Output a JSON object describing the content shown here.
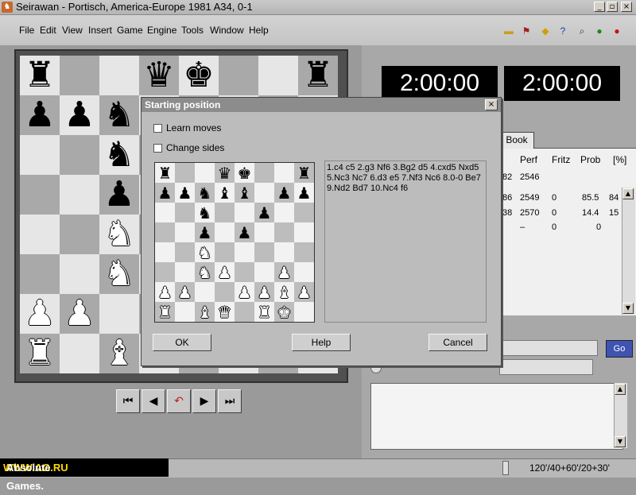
{
  "window": {
    "title": "Seirawan - Portisch, America-Europe 1981  A34, 0-1",
    "controls": [
      "_",
      "▫",
      "×"
    ]
  },
  "menu": [
    "File",
    "Edit",
    "View",
    "Insert",
    "Game",
    "Engine",
    "Tools",
    "Window",
    "Help"
  ],
  "toolbar_icons": [
    "folder-icon",
    "flag-icon",
    "warning-icon",
    "help-icon",
    "zoom-icon",
    "ok-icon",
    "stop-icon"
  ],
  "main_board": {
    "note": "visible position from screenshot (partially hidden by dialog)",
    "rows": [
      [
        "r",
        "",
        "",
        "q",
        "k",
        "",
        "",
        "r"
      ],
      [
        "p",
        "p",
        "n",
        "",
        "",
        "",
        "",
        ""
      ],
      [
        "",
        "",
        "n",
        "",
        "",
        "",
        "",
        ""
      ],
      [
        "",
        "",
        "p",
        "",
        "",
        "",
        "",
        ""
      ],
      [
        "",
        "",
        "N",
        "",
        "",
        "",
        "",
        ""
      ],
      [
        "",
        "",
        "N",
        "",
        "",
        "",
        "",
        ""
      ],
      [
        "P",
        "P",
        "",
        "",
        "",
        "",
        "",
        ""
      ],
      [
        "R",
        "",
        "B",
        "",
        "",
        "",
        "",
        ""
      ]
    ]
  },
  "nav_buttons": [
    "⏮",
    "◀",
    "↶",
    "▶",
    "⏭"
  ],
  "clocks": [
    "2:00:00",
    "2:00:00"
  ],
  "book_panel": {
    "tab": "Book",
    "headers": [
      "Perf",
      "Fritz",
      "Prob",
      "[%]"
    ],
    "rows": [
      [
        "82",
        "2546",
        "",
        "",
        ""
      ],
      [
        "86",
        "2549",
        "0",
        "85.5",
        "84"
      ],
      [
        "38",
        "2570",
        "0",
        "14.4",
        "15"
      ],
      [
        "",
        "–",
        "0",
        "0",
        ""
      ]
    ],
    "go_label": "Go"
  },
  "dialog": {
    "title": "Starting position",
    "learn_moves": "Learn moves",
    "change_sides": "Change sides",
    "moves_text": "1.c4 c5 2.g3 Nf6 3.Bg2 d5 4.cxd5 Nxd5 5.Nc3 Nc7 6.d3 e5 7.Nf3 Nc6 8.0-0 Be7 9.Nd2 Bd7 10.Nc4 f6",
    "mini_board": [
      [
        "r",
        "",
        "",
        "q",
        "k",
        "",
        "",
        "r"
      ],
      [
        "p",
        "p",
        "n",
        "b",
        "b",
        "",
        "p",
        "p"
      ],
      [
        "",
        "",
        "n",
        "",
        "",
        "p",
        "",
        ""
      ],
      [
        "",
        "",
        "p",
        "",
        "p",
        "",
        "",
        ""
      ],
      [
        "",
        "",
        "N",
        "",
        "",
        "",
        "",
        ""
      ],
      [
        "",
        "",
        "N",
        "P",
        "",
        "",
        "P",
        ""
      ],
      [
        "P",
        "P",
        "",
        "",
        "P",
        "P",
        "B",
        "P"
      ],
      [
        "R",
        "",
        "B",
        "Q",
        "",
        "R",
        "K",
        ""
      ]
    ],
    "ok_label": "OK",
    "help_label": "Help",
    "cancel_label": "Cancel"
  },
  "status": {
    "watermark_prefix": "Absolute Games. ",
    "watermark_url": "WWW.AG.RU",
    "time_control": "120'/40+60'/20+30'"
  }
}
